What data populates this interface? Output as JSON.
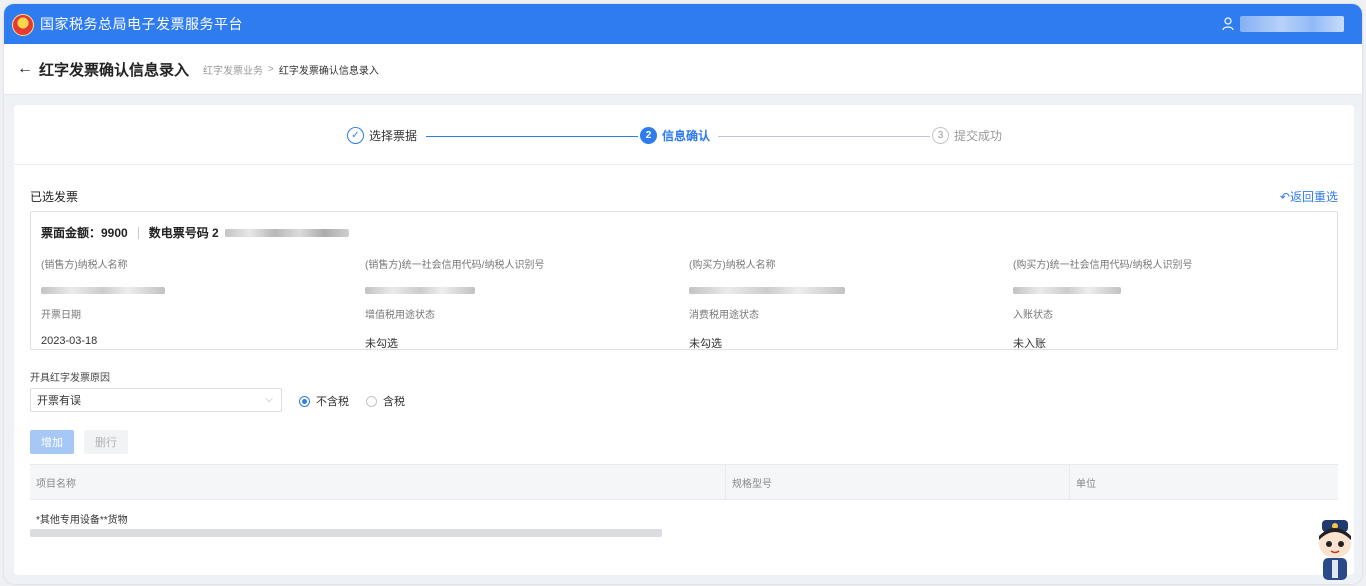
{
  "topbar": {
    "app_title": "国家税务总局电子发票服务平台",
    "user_icon": "user-icon"
  },
  "header": {
    "back_icon": "arrow-left-icon",
    "title": "红字发票确认信息录入",
    "breadcrumb": [
      "红字发票业务",
      "红字发票确认信息录入"
    ],
    "breadcrumb_sep": ">"
  },
  "steps": [
    {
      "num": "✓",
      "label": "选择票据",
      "state": "done"
    },
    {
      "num": "2",
      "label": "信息确认",
      "state": "active"
    },
    {
      "num": "3",
      "label": "提交成功",
      "state": "pending"
    }
  ],
  "selected": {
    "title": "已选发票",
    "reselect_label": "返回重选",
    "amount_label": "票面金额：9900",
    "invoice_no_label": "数电票号码 2",
    "fields_row1": [
      {
        "label": "(销售方)纳税人名称"
      },
      {
        "label": "(销售方)统一社会信用代码/纳税人识别号"
      },
      {
        "label": "(购买方)纳税人名称"
      },
      {
        "label": "(购买方)统一社会信用代码/纳税人识别号"
      }
    ],
    "fields_row2": [
      {
        "label": "开票日期",
        "value": "2023-03-18"
      },
      {
        "label": "增值税用途状态",
        "value": "未勾选"
      },
      {
        "label": "消费税用途状态",
        "value": "未勾选"
      },
      {
        "label": "入账状态",
        "value": "未入账"
      }
    ]
  },
  "form": {
    "reason_label": "开具红字发票原因",
    "reason_value": "开票有误",
    "tax_options": [
      {
        "label": "不含税",
        "checked": true
      },
      {
        "label": "含税",
        "checked": false
      }
    ],
    "add_label": "增加",
    "delete_label": "删行"
  },
  "table": {
    "columns": [
      "项目名称",
      "规格型号",
      "单位"
    ],
    "rows": [
      [
        "*其他专用设备**货物",
        "",
        ""
      ]
    ]
  },
  "colors": {
    "primary": "#2f7bf0",
    "header_bg": "#2f7bf0",
    "panel_bg": "#ffffff"
  }
}
